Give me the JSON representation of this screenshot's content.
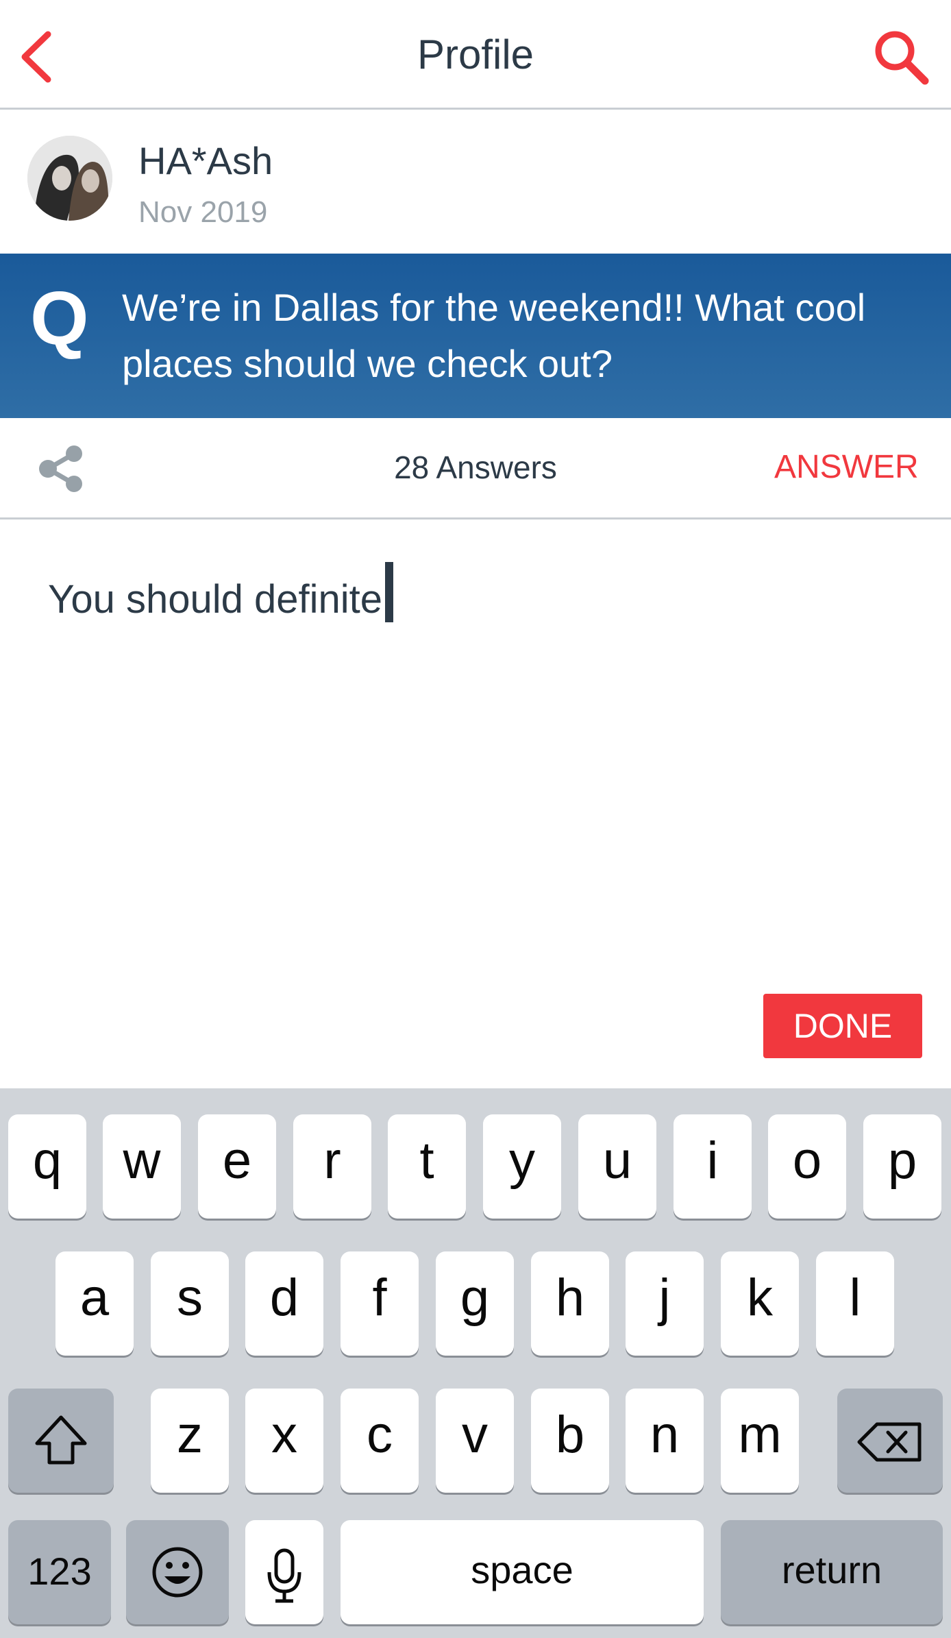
{
  "header": {
    "title": "Profile",
    "back_icon": "chevron-left-icon",
    "search_icon": "search-icon",
    "accent_color": "#f1383e"
  },
  "post": {
    "author": "HA*Ash",
    "date": "Nov 2019",
    "question_marker": "Q",
    "question": "We’re in Dallas for the weekend!! What cool places should we check out?",
    "question_bg": "#1a5a9a"
  },
  "actions": {
    "share_icon": "share-icon",
    "answers_count": "28 Answers",
    "answer_label": "ANSWER"
  },
  "compose": {
    "text": "You should definite",
    "done_label": "DONE"
  },
  "keyboard": {
    "row1": [
      "q",
      "w",
      "e",
      "r",
      "t",
      "y",
      "u",
      "i",
      "o",
      "p"
    ],
    "row2": [
      "a",
      "s",
      "d",
      "f",
      "g",
      "h",
      "j",
      "k",
      "l"
    ],
    "row3": [
      "z",
      "x",
      "c",
      "v",
      "b",
      "n",
      "m"
    ],
    "shift_icon": "shift-icon",
    "delete_icon": "backspace-icon",
    "numbers_label": "123",
    "emoji_icon": "emoji-icon",
    "mic_icon": "microphone-icon",
    "space_label": "space",
    "return_label": "return"
  }
}
